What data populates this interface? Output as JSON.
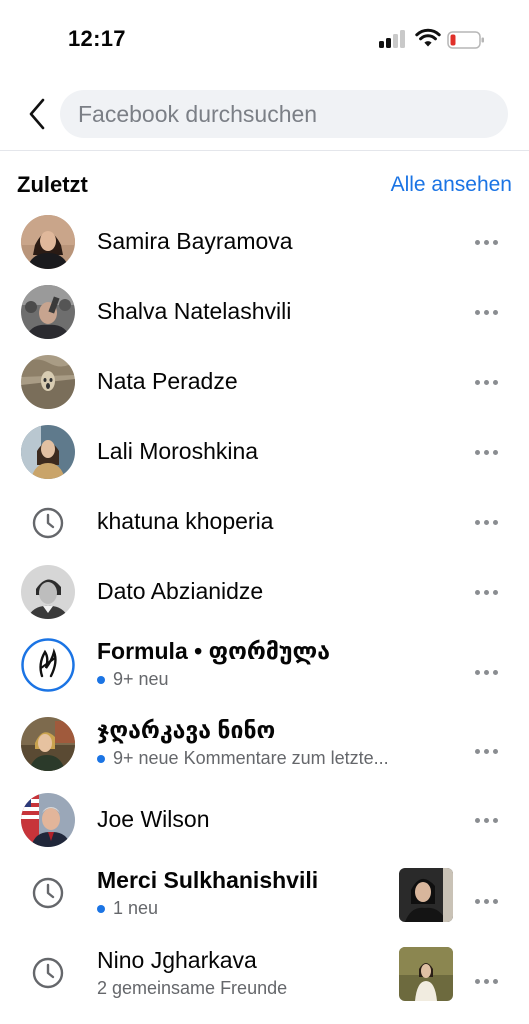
{
  "status_bar": {
    "time": "12:17"
  },
  "search": {
    "placeholder": "Facebook durchsuchen"
  },
  "section": {
    "title": "Zuletzt",
    "see_all": "Alle ansehen"
  },
  "items": [
    {
      "name": "Samira Bayramova",
      "icon": "avatar"
    },
    {
      "name": "Shalva Natelashvili",
      "icon": "avatar"
    },
    {
      "name": "Nata Peradze",
      "icon": "avatar"
    },
    {
      "name": "Lali Moroshkina",
      "icon": "avatar"
    },
    {
      "name": "khatuna khoperia",
      "icon": "clock-icon"
    },
    {
      "name": "Dato Abzianidze",
      "icon": "avatar"
    },
    {
      "name": "Formula • ფორმულა",
      "subtitle": "9+ neu",
      "unread": true,
      "icon": "avatar"
    },
    {
      "name": "ჯღარკავა ნინო",
      "subtitle": "9+ neue Kommentare zum letzte...",
      "unread": true,
      "icon": "avatar"
    },
    {
      "name": "Joe Wilson",
      "icon": "avatar"
    },
    {
      "name": "Merci Sulkhanishvili",
      "subtitle": "1 neu",
      "unread": true,
      "icon": "clock-icon",
      "thumbnail": true
    },
    {
      "name": "Nino Jgharkava",
      "subtitle": "2 gemeinsame Freunde",
      "unread": false,
      "icon": "clock-icon",
      "thumbnail": true
    }
  ],
  "colors": {
    "accent": "#1b74e4",
    "secondary_text": "#65676b",
    "search_bg": "#f0f2f5",
    "battery_low": "#e0302a"
  }
}
